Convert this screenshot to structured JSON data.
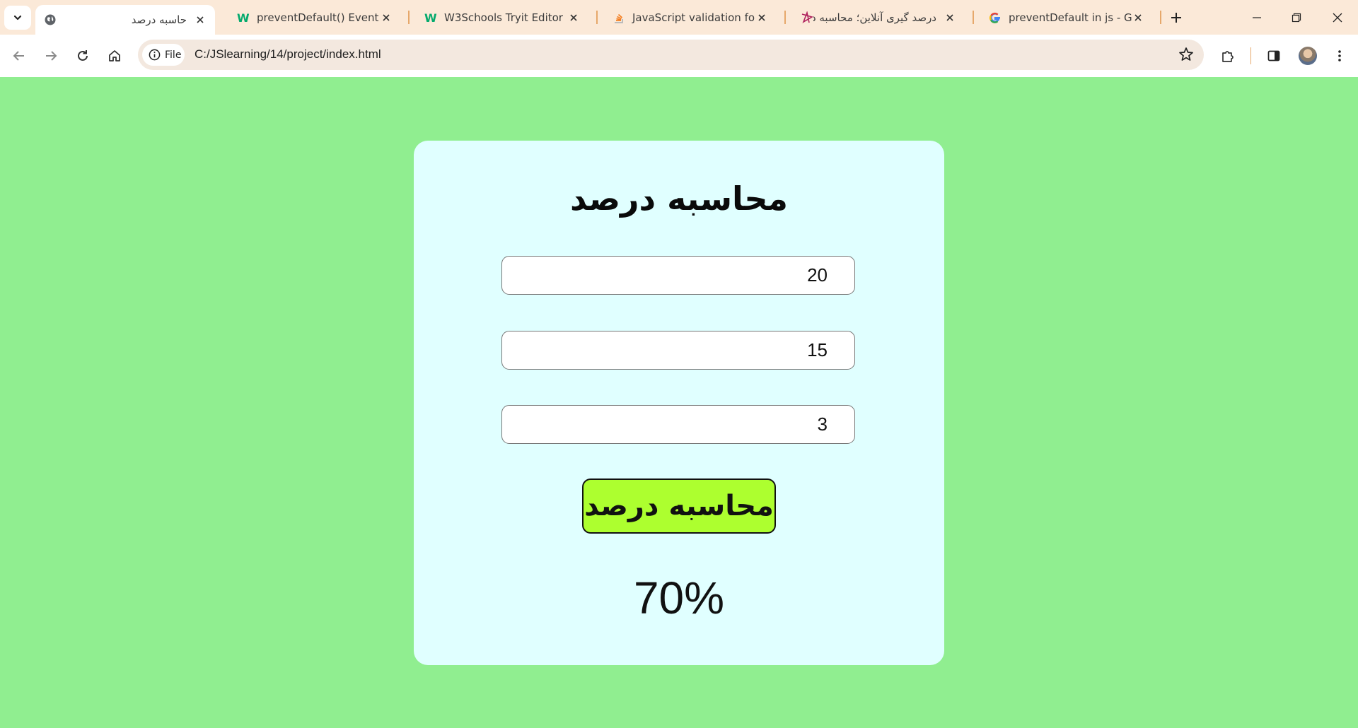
{
  "browser": {
    "tabs": [
      {
        "title": "حاسبه درصد",
        "favicon": "globe-icon",
        "active": true
      },
      {
        "title": "preventDefault() Event Met",
        "favicon": "w3schools-icon",
        "active": false
      },
      {
        "title": "W3Schools Tryit Editor",
        "favicon": "w3schools-icon",
        "active": false
      },
      {
        "title": "JavaScript validation for en",
        "favicon": "stackoverflow-icon",
        "active": false
      },
      {
        "title": "درصد گیری آنلاین؛ محاسبه د",
        "favicon": "star-logo-icon",
        "active": false
      },
      {
        "title": "preventDefault in js - Goo",
        "favicon": "google-icon",
        "active": false
      }
    ],
    "address": {
      "chip_label": "File",
      "url": "C:/JSlearning/14/project/index.html"
    },
    "colors": {
      "tab_strip": "#fbe9d8",
      "separator": "#e6a86b"
    }
  },
  "page": {
    "background": "#90ee90",
    "card_background": "#e0ffff",
    "title": "محاسبه درصد",
    "inputs": [
      {
        "value": "20"
      },
      {
        "value": "15"
      },
      {
        "value": "3"
      }
    ],
    "button_label": "محاسبه درصد",
    "button_color": "#adff2f",
    "result": "70%"
  }
}
